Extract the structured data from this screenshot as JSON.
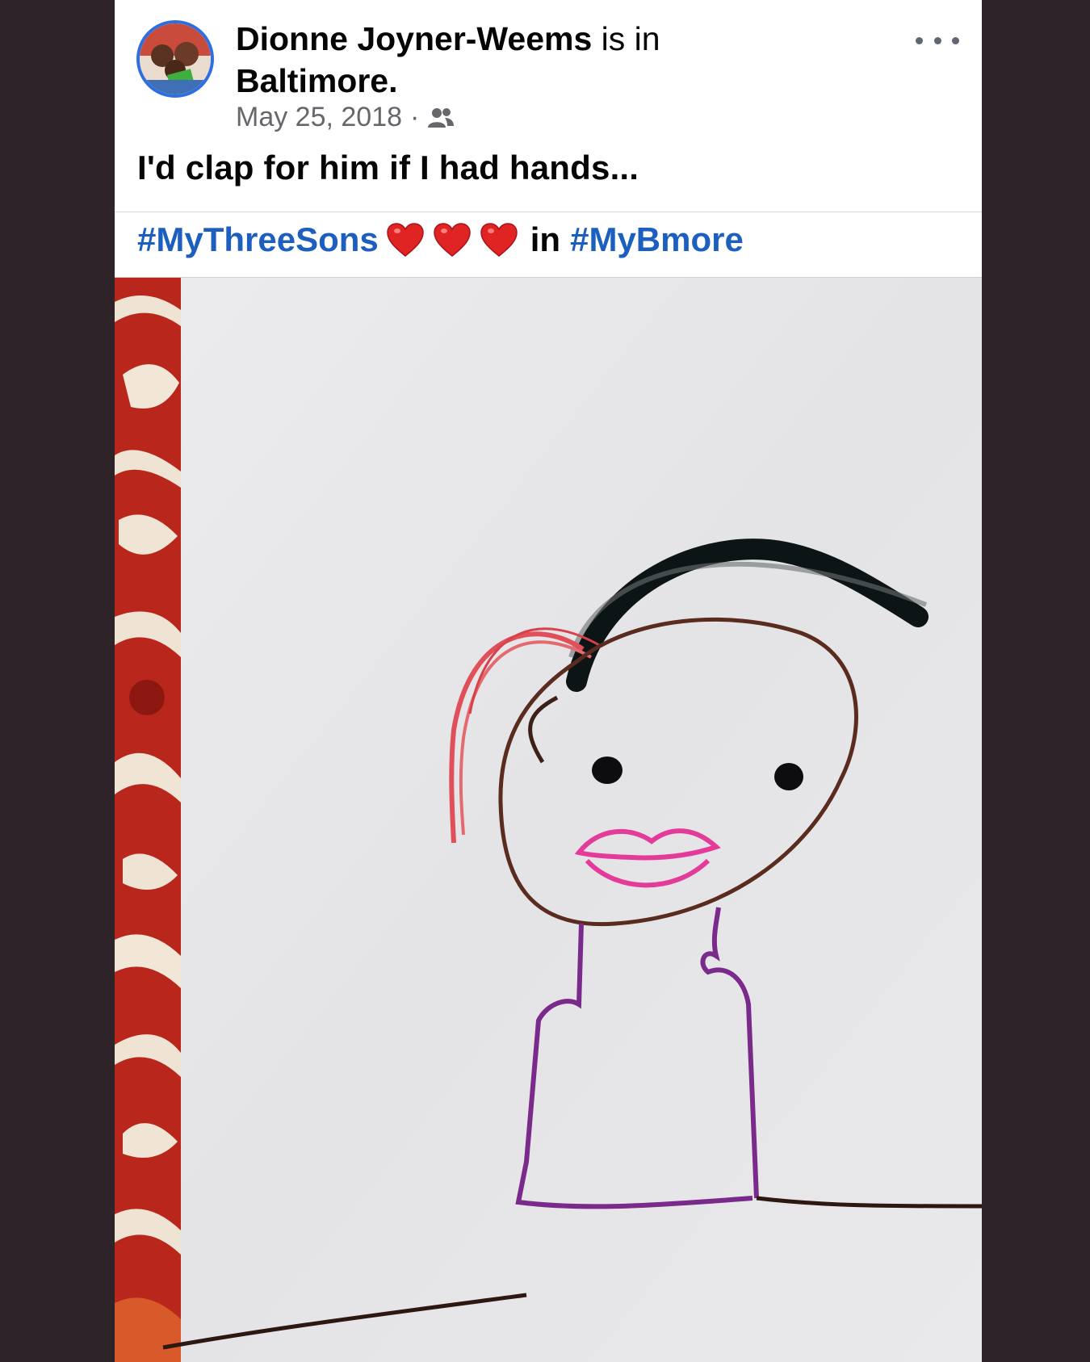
{
  "post": {
    "author": "Dionne Joyner-Weems",
    "location_prefix": "is in",
    "location": "Baltimore.",
    "date": "May 25, 2018",
    "separator": "·",
    "text": "I'd clap for him if I had hands...",
    "hashtag_1": "#MyThreeSons",
    "in_word": "in",
    "hashtag_2": "#MyBmore"
  },
  "icons": {
    "audience": "friends-audience-icon",
    "more": "more-options-icon",
    "heart": "red-heart-emoji"
  },
  "colors": {
    "hashtag": "#1d5fbf",
    "avatar_ring": "#2d6fe0",
    "meta_text": "#65676b",
    "background": "#2e2329"
  }
}
